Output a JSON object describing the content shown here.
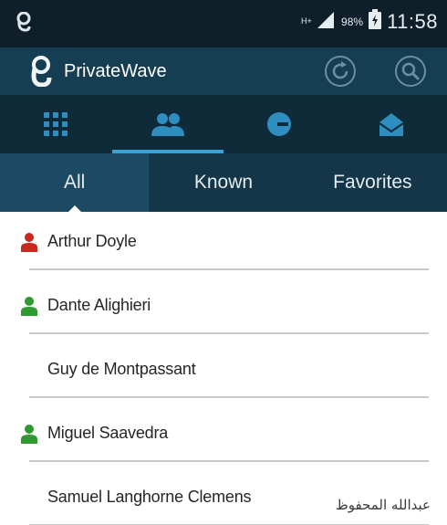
{
  "status_bar": {
    "network_type": "H+",
    "battery_percent": "98%",
    "time": "11:58"
  },
  "app_bar": {
    "title": "PrivateWave",
    "actions": [
      "refresh-icon",
      "search-icon"
    ]
  },
  "icon_tabs": [
    {
      "icon": "dialpad-icon",
      "active": false
    },
    {
      "icon": "contacts-icon",
      "active": true
    },
    {
      "icon": "recents-clock-icon",
      "active": false
    },
    {
      "icon": "messages-envelope-icon",
      "active": false
    }
  ],
  "filter_tabs": [
    {
      "label": "All",
      "active": true
    },
    {
      "label": "Known",
      "active": false
    },
    {
      "label": "Favorites",
      "active": false
    }
  ],
  "contacts": [
    {
      "name": "Arthur Doyle",
      "icon": "person-red-icon"
    },
    {
      "name": "Dante Alighieri",
      "icon": "person-green-icon"
    },
    {
      "name": "Guy de Montpassant",
      "icon": ""
    },
    {
      "name": "Miguel Saavedra",
      "icon": "person-green-icon"
    },
    {
      "name": "Samuel Langhorne Clemens",
      "icon": ""
    }
  ],
  "account_name": "عبدالله المحفوظ",
  "colors": {
    "status_bar": "#0e1f29",
    "app_bar": "#153e53",
    "tab_row": "#0f2a38",
    "tab_indicator": "#3aa3d6",
    "filter_tab": "#143648",
    "filter_tab_active": "#1b4a62",
    "person_red": "#c8281e",
    "person_green": "#2f9a2f"
  }
}
